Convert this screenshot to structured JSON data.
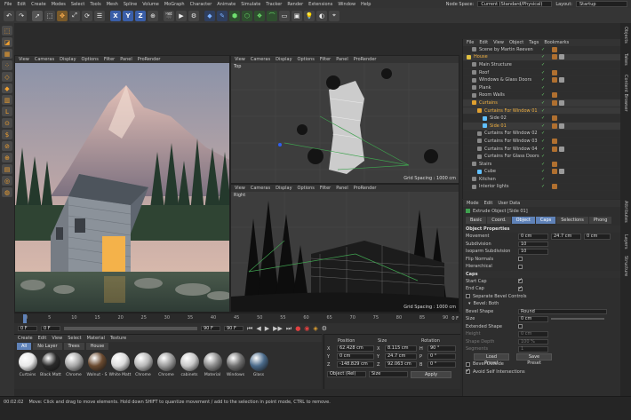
{
  "menubar": {
    "items": [
      "File",
      "Edit",
      "Create",
      "Modes",
      "Select",
      "Tools",
      "Mesh",
      "Spline",
      "Volume",
      "MoGraph",
      "Character",
      "Animate",
      "Simulate",
      "Tracker",
      "Render",
      "Extensions",
      "Window",
      "Help"
    ],
    "node_space_label": "Node Space:",
    "node_space_value": "Current (Standard/Physical)",
    "layout_label": "Layout:",
    "layout_value": "Startup"
  },
  "toolbar": {
    "axis_x": "X",
    "axis_y": "Y",
    "axis_z": "Z"
  },
  "viewport_menu": [
    "View",
    "Cameras",
    "Display",
    "Options",
    "Filter",
    "Panel",
    "ProRender"
  ],
  "viewports": {
    "top_label": "Top",
    "right_label": "Right",
    "grid_spacing_top": "Grid Spacing : 1000 cm",
    "grid_spacing_right": "Grid Spacing : 1000 cm"
  },
  "object_manager": {
    "menu": [
      "File",
      "Edit",
      "View",
      "Object",
      "Tags",
      "Bookmarks"
    ],
    "objects": [
      {
        "name": "Scene by Martin Reeven",
        "indent": 6,
        "color": "#888888"
      },
      {
        "name": "House",
        "indent": 0,
        "color": "#e0c040",
        "highlight": true
      },
      {
        "name": "Main Structure",
        "indent": 6,
        "color": "#888888"
      },
      {
        "name": "Roof",
        "indent": 6,
        "color": "#888888"
      },
      {
        "name": "Windows & Glass Doors",
        "indent": 6,
        "color": "#888888"
      },
      {
        "name": "Plank",
        "indent": 6,
        "color": "#888888"
      },
      {
        "name": "Room Walls",
        "indent": 6,
        "color": "#888888"
      },
      {
        "name": "Curtains",
        "indent": 6,
        "color": "#e0a030",
        "highlight": true
      },
      {
        "name": "Curtains For Window 01",
        "indent": 12,
        "color": "#e0a030",
        "highlight": true
      },
      {
        "name": "Side 02",
        "indent": 18,
        "color": "#60c0ff"
      },
      {
        "name": "Side 01",
        "indent": 18,
        "color": "#60c0ff",
        "highlight": true
      },
      {
        "name": "Curtains For Window 02",
        "indent": 12,
        "color": "#888888"
      },
      {
        "name": "Curtains For Window 03",
        "indent": 12,
        "color": "#888888"
      },
      {
        "name": "Curtains For Window 04",
        "indent": 12,
        "color": "#888888"
      },
      {
        "name": "Curtains For Glass Doors",
        "indent": 12,
        "color": "#888888"
      },
      {
        "name": "Stairs",
        "indent": 6,
        "color": "#888888"
      },
      {
        "name": "Cube",
        "indent": 12,
        "color": "#60c0ff"
      },
      {
        "name": "Kitchen",
        "indent": 6,
        "color": "#888888"
      },
      {
        "name": "Interior lights",
        "indent": 6,
        "color": "#888888"
      }
    ]
  },
  "attributes": {
    "menu": [
      "Mode",
      "Edit",
      "User Data"
    ],
    "object_title": "Extrude Object [Side 01]",
    "tabs": [
      "Basic",
      "Coord.",
      "Object",
      "Caps",
      "Selections",
      "Phong"
    ],
    "active_tabs": [
      "Object",
      "Caps"
    ],
    "section_object": "Object Properties",
    "movement_label": "Movement",
    "movement_values": [
      "0 cm",
      "24.7 cm",
      "0 cm"
    ],
    "subdivision_label": "Subdivision",
    "subdivision_value": "10",
    "isoparm_label": "Isoparm Subdivision",
    "isoparm_value": "10",
    "flip_normals_label": "Flip Normals",
    "hierarchical_label": "Hierarchical",
    "section_caps": "Caps",
    "start_cap_label": "Start Cap",
    "end_cap_label": "End Cap",
    "separate_bevel_label": "Separate Bevel Controls",
    "bevel_both_label": "Bevel: Both",
    "bevel_shape_label": "Bevel Shape",
    "bevel_shape_value": "Round",
    "size_label": "Size",
    "size_value": "0 cm",
    "extended_shape_label": "Extended Shape",
    "height_label": "Height",
    "height_value": "0 cm",
    "shape_depth_label": "Shape Depth",
    "shape_depth_value": "100 %",
    "segments_label": "Segments",
    "segments_value": "1",
    "load_preset_label": "Load Preset",
    "save_preset_label": "Save Preset",
    "bevel_outside_label": "Bevel Outside",
    "avoid_self_label": "Avoid Self Intersections"
  },
  "right_tabs": [
    "Objects",
    "Takes",
    "Content Browser",
    "Attributes",
    "Layers",
    "Structure"
  ],
  "timeline": {
    "ticks": [
      "0",
      "5",
      "10",
      "15",
      "20",
      "25",
      "30",
      "35",
      "40",
      "45",
      "50",
      "55",
      "60",
      "65",
      "70",
      "75",
      "80",
      "85",
      "90"
    ],
    "frame_end_label": "0 F",
    "current_frame": "0 F",
    "start_field": "0 F",
    "end_field": "90 F",
    "end_field2": "90 F"
  },
  "material_manager": {
    "menu": [
      "Create",
      "Edit",
      "View",
      "Select",
      "Material",
      "Texture"
    ],
    "filters": [
      "All",
      "No Layer",
      "Trees",
      "House"
    ],
    "materials": [
      {
        "name": "Curtains",
        "color": "#e8e8e8"
      },
      {
        "name": "Black Matt",
        "color": "#2a2a2a"
      },
      {
        "name": "Chrome",
        "color": "#a8a8a8"
      },
      {
        "name": "Walnut - S",
        "color": "#6a4a30"
      },
      {
        "name": "White Matt",
        "color": "#dcdcdc"
      },
      {
        "name": "Chrome",
        "color": "#b8b8b8"
      },
      {
        "name": "Chrome",
        "color": "#9a9a9a"
      },
      {
        "name": "cabinets",
        "color": "#c8c8c8"
      },
      {
        "name": "Material",
        "color": "#8a8a8a"
      },
      {
        "name": "Windows",
        "color": "#707070"
      },
      {
        "name": "Glass",
        "color": "#4a6a8a"
      }
    ]
  },
  "coordinates": {
    "header_position": "Position",
    "header_size": "Size",
    "header_rotation": "Rotation",
    "rows": [
      {
        "axis": "X",
        "pos": "62.428 cm",
        "size_axis": "X",
        "size": "8.115 cm",
        "rot_axis": "H",
        "rot": "90 °"
      },
      {
        "axis": "Y",
        "pos": "0 cm",
        "size_axis": "Y",
        "size": "24.7 cm",
        "rot_axis": "P",
        "rot": "0 °"
      },
      {
        "axis": "Z",
        "pos": "-148.829 cm",
        "size_axis": "Z",
        "size": "92.063 cm",
        "rot_axis": "B",
        "rot": "0 °"
      }
    ],
    "mode_select": "Object (Rel)",
    "size_select": "Size",
    "apply_label": "Apply"
  },
  "status": {
    "time": "00:02:02",
    "message": "Move: Click and drag to move elements. Hold down SHIFT to quantize movement / add to the selection in point mode, CTRL to remove."
  }
}
